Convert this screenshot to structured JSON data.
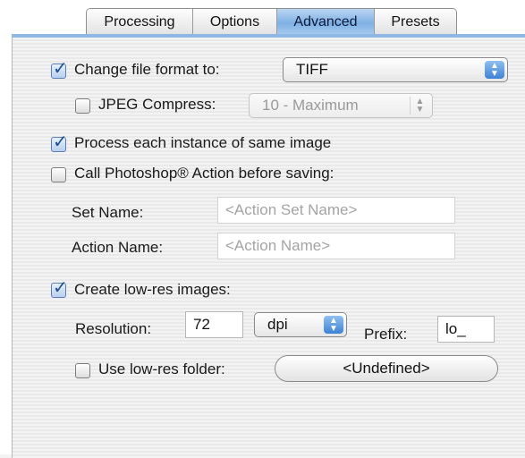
{
  "tabs": [
    {
      "label": "Processing",
      "active": false
    },
    {
      "label": "Options",
      "active": false
    },
    {
      "label": "Advanced",
      "active": true
    },
    {
      "label": "Presets",
      "active": false
    }
  ],
  "change_format": {
    "label": "Change file format to:",
    "checked": true,
    "value": "TIFF"
  },
  "jpeg_compress": {
    "label": "JPEG Compress:",
    "checked": false,
    "value": "10 - Maximum"
  },
  "process_instance": {
    "label": "Process each instance of same image",
    "checked": true
  },
  "call_action": {
    "label": "Call Photoshop® Action before saving:",
    "checked": false
  },
  "set_name": {
    "label": "Set Name:",
    "placeholder": "<Action Set Name>"
  },
  "action_name": {
    "label": "Action Name:",
    "placeholder": "<Action Name>"
  },
  "lowres": {
    "label": "Create low-res images:",
    "checked": true
  },
  "resolution": {
    "label": "Resolution:",
    "value": "72",
    "unit": "dpi"
  },
  "prefix": {
    "label": "Prefix:",
    "value": "lo_"
  },
  "lowres_folder": {
    "label": "Use low-res folder:",
    "checked": false,
    "button": "<Undefined>"
  },
  "colors": {
    "accent": "#8fb7e3",
    "active_tab": "#7fb0e4",
    "check": "#1e4f93"
  }
}
